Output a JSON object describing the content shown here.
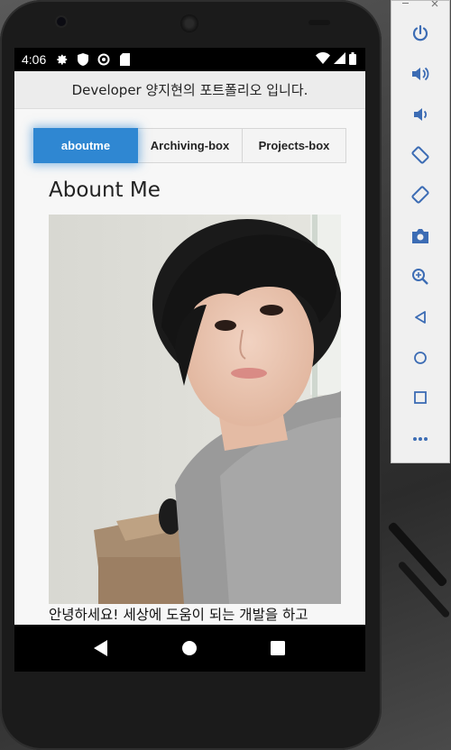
{
  "status_bar": {
    "time": "4:06",
    "icons": [
      "gear-icon",
      "shield-icon",
      "sync-icon",
      "sd-card-icon"
    ],
    "right_icons": [
      "wifi-icon",
      "signal-icon",
      "battery-icon"
    ]
  },
  "app": {
    "title": "Developer 양지현의 포트폴리오 입니다."
  },
  "tabs": [
    {
      "label": "aboutme",
      "active": true
    },
    {
      "label": "Archiving-box",
      "active": false
    },
    {
      "label": "Projects-box",
      "active": false
    }
  ],
  "main": {
    "section_title": "Abount Me",
    "intro_text": "안녕하세요! 세상에 도움이 되는 개발을 하고"
  },
  "nav": {
    "buttons": [
      "back-icon",
      "home-icon",
      "recents-icon"
    ]
  },
  "emulator_toolbar": {
    "window_controls": [
      "minimize-icon",
      "close-icon"
    ],
    "buttons": [
      "power-icon",
      "volume-up-icon",
      "volume-down-icon",
      "rotate-left-icon",
      "rotate-right-icon",
      "camera-icon",
      "zoom-icon",
      "back-icon",
      "home-icon",
      "overview-icon",
      "more-icon"
    ]
  },
  "colors": {
    "accent": "#2f87d2",
    "toolbar_icon": "#3c6cb4"
  }
}
